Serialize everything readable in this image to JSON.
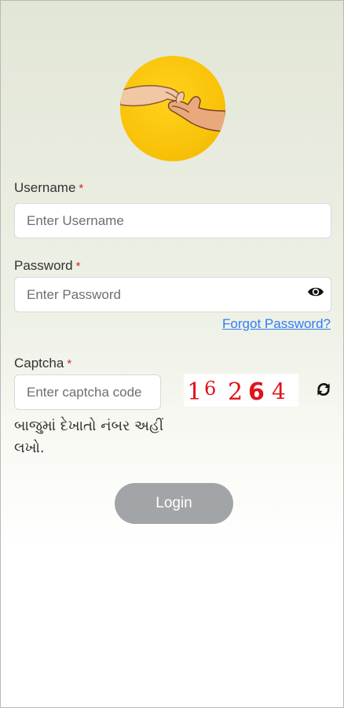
{
  "logo": {
    "icon": "helping-hands-icon",
    "color": "#f9c30a"
  },
  "form": {
    "username": {
      "label": "Username",
      "required_mark": "*",
      "placeholder": "Enter Username",
      "value": ""
    },
    "password": {
      "label": "Password",
      "required_mark": "*",
      "placeholder": "Enter Password",
      "value": "",
      "toggle_icon": "eye-icon"
    },
    "forgot_password": "Forgot Password?",
    "captcha": {
      "label": "Captcha",
      "required_mark": "*",
      "placeholder": "Enter captcha code",
      "value": "",
      "image_text": "16264",
      "refresh_icon": "refresh-icon",
      "hint": "બાજુમાં દેખાતો નંબર અહીં લખો."
    },
    "login_button": "Login"
  },
  "colors": {
    "required": "#d9262c",
    "link": "#2f7df6",
    "button": "#a2a5a8",
    "captcha_text": "#e0131b"
  }
}
